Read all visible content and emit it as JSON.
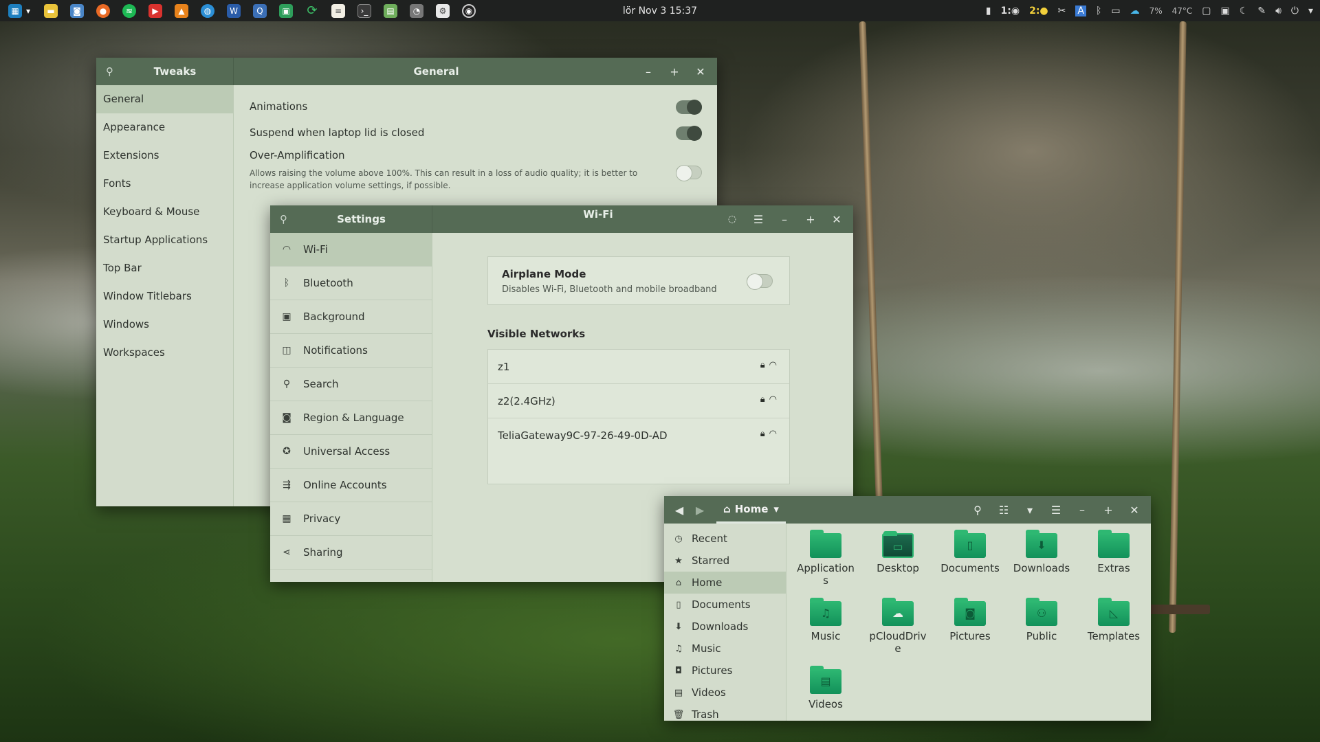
{
  "topbar": {
    "clock": "lör Nov 3  15:37",
    "workspace1": "1:",
    "workspace2": "2:",
    "battery": "7%",
    "temperature": "47°C",
    "app_icons": [
      "menu-icon",
      "sticky-notes-icon",
      "screenshot-icon",
      "firefox-icon",
      "spotify-icon",
      "youtube-icon",
      "vlc-icon",
      "globe-icon",
      "word-icon",
      "qbittorrent-icon",
      "terminal-green-icon",
      "refresh-icon",
      "notes-icon",
      "terminal-icon",
      "image-viewer-icon",
      "system-monitor-icon",
      "settings-icon",
      "obs-icon"
    ]
  },
  "tweaks": {
    "sidebar_title": "Tweaks",
    "title": "General",
    "items": [
      "General",
      "Appearance",
      "Extensions",
      "Fonts",
      "Keyboard & Mouse",
      "Startup Applications",
      "Top Bar",
      "Window Titlebars",
      "Windows",
      "Workspaces"
    ],
    "active_index": 0,
    "animations_label": "Animations",
    "animations_on": true,
    "suspend_label": "Suspend when laptop lid is closed",
    "suspend_on": true,
    "overamp_label": "Over-Amplification",
    "overamp_desc": "Allows raising the volume above 100%. This can result in a loss of audio quality; it is better to increase application volume settings, if possible.",
    "overamp_on": false
  },
  "settings": {
    "sidebar_title": "Settings",
    "title": "Wi-Fi",
    "items": [
      {
        "label": "Wi-Fi",
        "icon": "wifi-icon"
      },
      {
        "label": "Bluetooth",
        "icon": "bluetooth-icon"
      },
      {
        "label": "Background",
        "icon": "background-icon"
      },
      {
        "label": "Notifications",
        "icon": "notifications-icon"
      },
      {
        "label": "Search",
        "icon": "search-icon"
      },
      {
        "label": "Region & Language",
        "icon": "region-icon"
      },
      {
        "label": "Universal Access",
        "icon": "accessibility-icon"
      },
      {
        "label": "Online Accounts",
        "icon": "online-accounts-icon"
      },
      {
        "label": "Privacy",
        "icon": "privacy-icon"
      },
      {
        "label": "Sharing",
        "icon": "sharing-icon"
      }
    ],
    "airplane_title": "Airplane Mode",
    "airplane_desc": "Disables Wi-Fi, Bluetooth and mobile broadband",
    "airplane_on": false,
    "visible_networks_label": "Visible Networks",
    "networks": [
      "z1",
      "z2(2.4GHz)",
      "TeliaGateway9C-97-26-49-0D-AD"
    ]
  },
  "files": {
    "location": "Home",
    "sidebar": [
      {
        "label": "Recent",
        "icon": "clock-icon"
      },
      {
        "label": "Starred",
        "icon": "star-icon"
      },
      {
        "label": "Home",
        "icon": "home-icon"
      },
      {
        "label": "Documents",
        "icon": "document-icon"
      },
      {
        "label": "Downloads",
        "icon": "download-icon"
      },
      {
        "label": "Music",
        "icon": "music-icon"
      },
      {
        "label": "Pictures",
        "icon": "pictures-icon"
      },
      {
        "label": "Videos",
        "icon": "video-icon"
      },
      {
        "label": "Trash",
        "icon": "trash-icon"
      }
    ],
    "active_index": 2,
    "folders": [
      {
        "line1": "Application",
        "line2": "s"
      },
      {
        "line1": "Desktop",
        "line2": ""
      },
      {
        "line1": "Documents",
        "line2": ""
      },
      {
        "line1": "Downloads",
        "line2": ""
      },
      {
        "line1": "Extras",
        "line2": ""
      },
      {
        "line1": "Music",
        "line2": ""
      },
      {
        "line1": "pCloudDriv",
        "line2": "e"
      },
      {
        "line1": "Pictures",
        "line2": ""
      },
      {
        "line1": "Public",
        "line2": ""
      },
      {
        "line1": "Templates",
        "line2": ""
      },
      {
        "line1": "Videos",
        "line2": ""
      }
    ]
  }
}
